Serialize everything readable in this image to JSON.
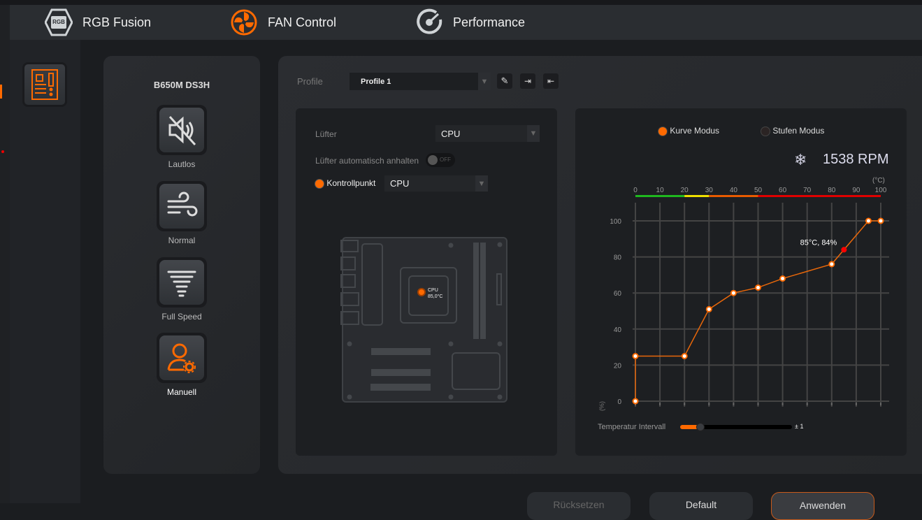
{
  "nav": {
    "items": [
      {
        "label": "RGB Fusion",
        "icon": "rgb-fusion-logo"
      },
      {
        "label": "FAN Control",
        "icon": "fan-icon"
      },
      {
        "label": "Performance",
        "icon": "gauge-icon"
      }
    ],
    "logo_text": "RGB FUSION"
  },
  "board": {
    "name": "B650M DS3H"
  },
  "modes": [
    {
      "label": "Lautlos",
      "icon": "mute-speaker-icon"
    },
    {
      "label": "Normal",
      "icon": "wind-icon"
    },
    {
      "label": "Full Speed",
      "icon": "tornado-icon"
    },
    {
      "label": "Manuell",
      "icon": "user-gear-icon",
      "active": true
    }
  ],
  "profile": {
    "label": "Profile",
    "value": "Profile 1"
  },
  "fan": {
    "label": "Lüfter",
    "value": "CPU",
    "auto_stop_label": "Lüfter automatisch anhalten",
    "auto_stop_state": "OFF",
    "control_label": "Kontrollpunkt",
    "control_value": "CPU",
    "cpu_sensor_label": "CPU",
    "cpu_temp": "85,0°C"
  },
  "curve": {
    "modes": [
      {
        "label": "Kurve Modus",
        "selected": true
      },
      {
        "label": "Stufen Modus",
        "selected": false
      }
    ],
    "rpm": "1538 RPM",
    "interval_label": "Temperatur Intervall",
    "interval_value": "± 1",
    "interval_fraction": 0.18
  },
  "chart_data": {
    "type": "line",
    "x_unit": "(°C)",
    "y_unit": "(%)",
    "xlim": [
      0,
      100
    ],
    "ylim": [
      0,
      100
    ],
    "x_ticks": [
      0,
      10,
      20,
      30,
      40,
      50,
      60,
      70,
      80,
      90,
      100
    ],
    "y_ticks": [
      0,
      20,
      40,
      60,
      80,
      100
    ],
    "points": [
      [
        0,
        0
      ],
      [
        0,
        25
      ],
      [
        20,
        25
      ],
      [
        30,
        51
      ],
      [
        40,
        60
      ],
      [
        50,
        63
      ],
      [
        60,
        68
      ],
      [
        80,
        76
      ],
      [
        95,
        100
      ],
      [
        100,
        100
      ]
    ],
    "current": {
      "x": 85,
      "y": 84,
      "label": "85°C, 84%"
    },
    "temp_bar": [
      {
        "from": 0,
        "to": 20,
        "color": "#1fb81f"
      },
      {
        "from": 20,
        "to": 30,
        "color": "#f0e000"
      },
      {
        "from": 30,
        "to": 50,
        "color": "#e85a00"
      },
      {
        "from": 50,
        "to": 100,
        "color": "#e00000"
      }
    ],
    "grid": true,
    "line_color": "#e8670a"
  },
  "footer": {
    "buttons": [
      "Rücksetzen",
      "Default",
      "Anwenden"
    ]
  },
  "colors": {
    "accent": "#ff6a00"
  }
}
